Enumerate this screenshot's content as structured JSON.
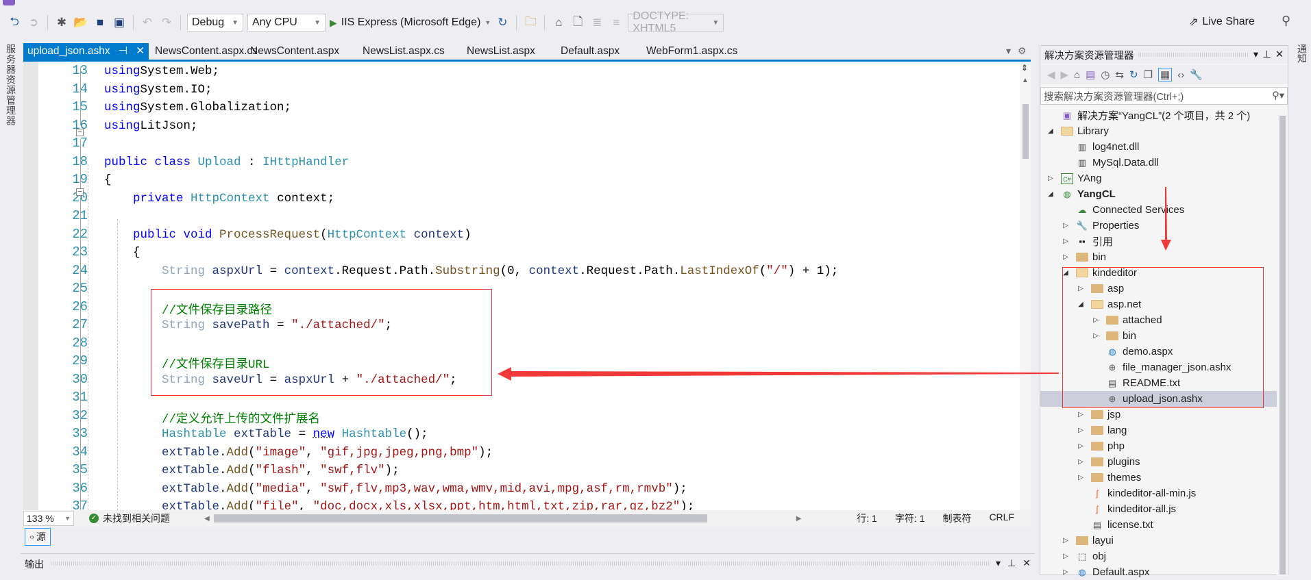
{
  "toolbar": {
    "config": "Debug",
    "platform": "Any CPU",
    "run_target": "IIS Express (Microsoft Edge)",
    "doctype": "DOCTYPE: XHTML5",
    "live_share": "Live Share"
  },
  "left_strip": {
    "label": "服务器资源管理器"
  },
  "right_strip": {
    "label": "通知"
  },
  "tabs": [
    {
      "label": "upload_json.ashx",
      "active": true
    },
    {
      "label": "NewsContent.aspx.cs"
    },
    {
      "label": "NewsContent.aspx"
    },
    {
      "label": "NewsList.aspx.cs"
    },
    {
      "label": "NewsList.aspx"
    },
    {
      "label": "Default.aspx"
    },
    {
      "label": "WebForm1.aspx.cs"
    }
  ],
  "editor": {
    "first_line": 13,
    "lines": [
      [
        [
          "kw",
          "using"
        ],
        [
          "",
          "System.Web;"
        ]
      ],
      [
        [
          "kw",
          "using"
        ],
        [
          "",
          "System.IO;"
        ]
      ],
      [
        [
          "kw",
          "using"
        ],
        [
          "",
          "System.Globalization;"
        ]
      ],
      [
        [
          "kw",
          "using"
        ],
        [
          "",
          "LitJson;"
        ]
      ],
      [],
      [
        [
          "kw",
          "public class "
        ],
        [
          "ty",
          "Upload"
        ],
        [
          "",
          " : "
        ],
        [
          "ty",
          "IHttpHandler"
        ]
      ],
      [
        [
          "",
          "{"
        ]
      ],
      [
        [
          "",
          "    "
        ],
        [
          "kw",
          "private "
        ],
        [
          "ty",
          "HttpContext"
        ],
        [
          "",
          " context;"
        ]
      ],
      [],
      [
        [
          "",
          "    "
        ],
        [
          "kw",
          "public void "
        ],
        [
          "me",
          "ProcessRequest"
        ],
        [
          "",
          "("
        ],
        [
          "ty",
          "HttpContext"
        ],
        [
          "",
          " "
        ],
        [
          "va",
          "context"
        ],
        [
          "",
          ")"
        ]
      ],
      [
        [
          "",
          "    {"
        ]
      ],
      [
        [
          "",
          "        "
        ],
        [
          "fd",
          "String"
        ],
        [
          "",
          " "
        ],
        [
          "va",
          "aspxUrl"
        ],
        [
          "",
          " = "
        ],
        [
          "va",
          "context"
        ],
        [
          "",
          ".Request.Path."
        ],
        [
          "me",
          "Substring"
        ],
        [
          "",
          "(0, "
        ],
        [
          "va",
          "context"
        ],
        [
          "",
          ".Request.Path."
        ],
        [
          "me",
          "LastIndexOf"
        ],
        [
          "",
          "("
        ],
        [
          "st",
          "\"/\""
        ],
        [
          "",
          ") + 1);"
        ]
      ],
      [],
      [
        [
          "",
          "        "
        ],
        [
          "cm",
          "//文件保存目录路径"
        ]
      ],
      [
        [
          "",
          "        "
        ],
        [
          "fd",
          "String"
        ],
        [
          "",
          " "
        ],
        [
          "va",
          "savePath"
        ],
        [
          "",
          " = "
        ],
        [
          "st",
          "\"./attached/\""
        ],
        [
          "",
          ";"
        ]
      ],
      [],
      [
        [
          "",
          "        "
        ],
        [
          "cm",
          "//文件保存目录URL"
        ]
      ],
      [
        [
          "",
          "        "
        ],
        [
          "fd",
          "String"
        ],
        [
          "",
          " "
        ],
        [
          "va",
          "saveUrl"
        ],
        [
          "",
          " = "
        ],
        [
          "va",
          "aspxUrl"
        ],
        [
          "",
          " + "
        ],
        [
          "st",
          "\"./attached/\""
        ],
        [
          "",
          ";"
        ]
      ],
      [],
      [
        [
          "",
          "        "
        ],
        [
          "cm",
          "//定义允许上传的文件扩展名"
        ]
      ],
      [
        [
          "",
          "        "
        ],
        [
          "ty",
          "Hashtable"
        ],
        [
          "",
          " "
        ],
        [
          "va",
          "extTable"
        ],
        [
          "",
          " = "
        ],
        [
          "kw nw",
          "new"
        ],
        [
          "",
          " "
        ],
        [
          "ty",
          "Hashtable"
        ],
        [
          "",
          "();"
        ]
      ],
      [
        [
          "",
          "        "
        ],
        [
          "va",
          "extTable"
        ],
        [
          "",
          "."
        ],
        [
          "me",
          "Add"
        ],
        [
          "",
          "("
        ],
        [
          "st",
          "\"image\""
        ],
        [
          "",
          ", "
        ],
        [
          "st",
          "\"gif,jpg,jpeg,png,bmp\""
        ],
        [
          "",
          ");"
        ]
      ],
      [
        [
          "",
          "        "
        ],
        [
          "va",
          "extTable"
        ],
        [
          "",
          "."
        ],
        [
          "me",
          "Add"
        ],
        [
          "",
          "("
        ],
        [
          "st",
          "\"flash\""
        ],
        [
          "",
          ", "
        ],
        [
          "st",
          "\"swf,flv\""
        ],
        [
          "",
          ");"
        ]
      ],
      [
        [
          "",
          "        "
        ],
        [
          "va",
          "extTable"
        ],
        [
          "",
          "."
        ],
        [
          "me",
          "Add"
        ],
        [
          "",
          "("
        ],
        [
          "st",
          "\"media\""
        ],
        [
          "",
          ", "
        ],
        [
          "st",
          "\"swf,flv,mp3,wav,wma,wmv,mid,avi,mpg,asf,rm,rmvb\""
        ],
        [
          "",
          ");"
        ]
      ],
      [
        [
          "",
          "        "
        ],
        [
          "va",
          "extTable"
        ],
        [
          "",
          "."
        ],
        [
          "me",
          "Add"
        ],
        [
          "",
          "("
        ],
        [
          "st",
          "\"file\""
        ],
        [
          "",
          ", "
        ],
        [
          "st",
          "\"doc,docx,xls,xlsx,ppt,htm,html,txt,zip,rar,gz,bz2\""
        ],
        [
          "",
          ");"
        ]
      ]
    ]
  },
  "status": {
    "zoom": "133 %",
    "issues": "未找到相关问题",
    "line": "行: 1",
    "char": "字符: 1",
    "indent": "制表符",
    "eol": "CRLF"
  },
  "source_button": "源",
  "output_panel": {
    "title": "输出"
  },
  "solution_explorer": {
    "title": "解决方案资源管理器",
    "search_placeholder": "搜索解决方案资源管理器(Ctrl+;)",
    "items": [
      {
        "level": 0,
        "exp": "",
        "icon": "solution-icon",
        "label": "解决方案“YangCL”(2 个项目，共 2 个)"
      },
      {
        "level": 0,
        "exp": "open",
        "icon": "folder-open-icon",
        "label": "Library"
      },
      {
        "level": 1,
        "exp": "",
        "icon": "assembly-icon",
        "label": "log4net.dll"
      },
      {
        "level": 1,
        "exp": "",
        "icon": "assembly-icon",
        "label": "MySql.Data.dll"
      },
      {
        "level": 0,
        "exp": "closed",
        "icon": "csharp-project-icon",
        "label": "YAng"
      },
      {
        "level": 0,
        "exp": "open",
        "icon": "web-project-icon",
        "label": "YangCL",
        "bold": true
      },
      {
        "level": 1,
        "exp": "",
        "icon": "connected-services-icon",
        "label": "Connected Services"
      },
      {
        "level": 1,
        "exp": "closed",
        "icon": "wrench-icon",
        "label": "Properties"
      },
      {
        "level": 1,
        "exp": "closed",
        "icon": "references-icon",
        "label": "引用"
      },
      {
        "level": 1,
        "exp": "closed",
        "icon": "folder-icon",
        "label": "bin"
      },
      {
        "level": 1,
        "exp": "open",
        "icon": "folder-open-icon",
        "label": "kindeditor"
      },
      {
        "level": 2,
        "exp": "closed",
        "icon": "folder-icon",
        "label": "asp"
      },
      {
        "level": 2,
        "exp": "open",
        "icon": "folder-open-icon",
        "label": "asp.net"
      },
      {
        "level": 3,
        "exp": "closed",
        "icon": "folder-icon",
        "label": "attached"
      },
      {
        "level": 3,
        "exp": "closed",
        "icon": "folder-icon",
        "label": "bin"
      },
      {
        "level": 3,
        "exp": "",
        "icon": "aspx-file-icon",
        "label": "demo.aspx"
      },
      {
        "level": 3,
        "exp": "",
        "icon": "handler-file-icon",
        "label": "file_manager_json.ashx"
      },
      {
        "level": 3,
        "exp": "",
        "icon": "text-file-icon",
        "label": "README.txt"
      },
      {
        "level": 3,
        "exp": "",
        "icon": "handler-file-icon",
        "label": "upload_json.ashx",
        "selected": true
      },
      {
        "level": 2,
        "exp": "closed",
        "icon": "folder-icon",
        "label": "jsp"
      },
      {
        "level": 2,
        "exp": "closed",
        "icon": "folder-icon",
        "label": "lang"
      },
      {
        "level": 2,
        "exp": "closed",
        "icon": "folder-icon",
        "label": "php"
      },
      {
        "level": 2,
        "exp": "closed",
        "icon": "folder-icon",
        "label": "plugins"
      },
      {
        "level": 2,
        "exp": "closed",
        "icon": "folder-icon",
        "label": "themes"
      },
      {
        "level": 2,
        "exp": "",
        "icon": "js-file-icon",
        "label": "kindeditor-all-min.js"
      },
      {
        "level": 2,
        "exp": "",
        "icon": "js-file-icon",
        "label": "kindeditor-all.js"
      },
      {
        "level": 2,
        "exp": "",
        "icon": "text-file-icon",
        "label": "license.txt"
      },
      {
        "level": 1,
        "exp": "closed",
        "icon": "folder-icon",
        "label": "layui"
      },
      {
        "level": 1,
        "exp": "closed",
        "icon": "hidden-folder-icon",
        "label": "obj"
      },
      {
        "level": 1,
        "exp": "closed",
        "icon": "aspx-file-icon",
        "label": "Default.aspx"
      }
    ]
  },
  "colors": {
    "accent": "#007acc",
    "annotation": "#f03a3a",
    "selection": "#cccedb"
  }
}
